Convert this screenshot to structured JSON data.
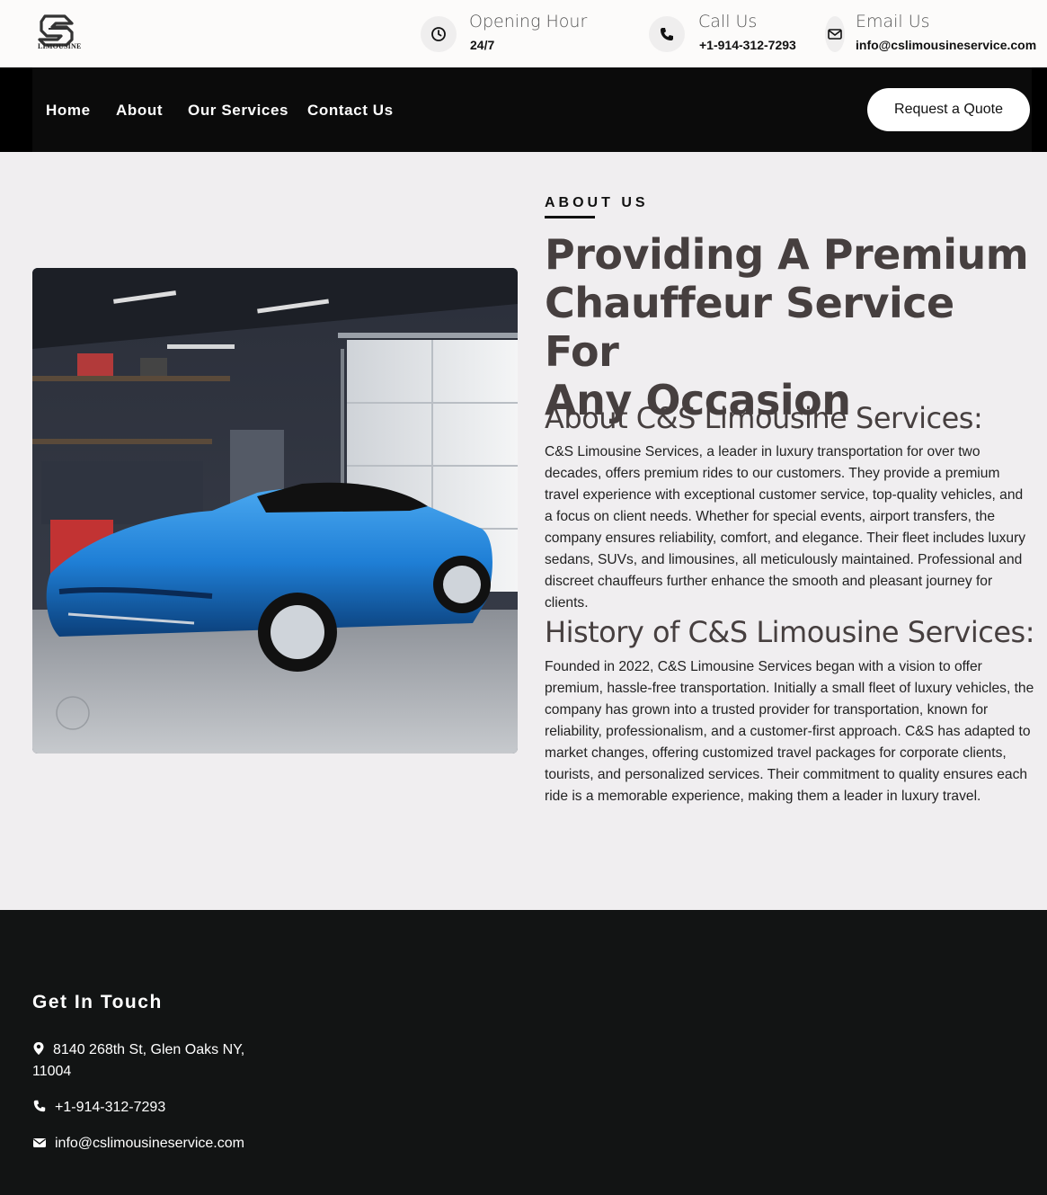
{
  "brand": {
    "logo_text": "LIMOUSINE"
  },
  "topbar": {
    "opening": {
      "title": "Opening Hour",
      "value": "24/7",
      "icon": "clock-icon"
    },
    "call": {
      "title": "Call Us",
      "value": "+1-914-312-7293",
      "icon": "phone-icon"
    },
    "email": {
      "title": "Email Us",
      "value": "info@cslimousineservice.com",
      "icon": "envelope-icon"
    }
  },
  "nav": {
    "items": [
      "Home",
      "About",
      "Our Services",
      "Contact Us"
    ],
    "cta": "Request a Quote"
  },
  "about": {
    "eyebrow": "ABOUT US",
    "headline_1": "Providing A Premium",
    "headline_2": "Chauffeur Service For",
    "headline_3": "Any Occasion",
    "section1_title": "About C&S Limousine Services:",
    "section1_text": "C&S Limousine Services, a leader in luxury transportation for over two decades, offers premium rides to our customers. They provide a premium travel experience with exceptional customer service, top-quality vehicles, and a focus on client needs. Whether for special events, airport transfers, the company ensures reliability, comfort, and elegance. Their fleet includes luxury sedans, SUVs, and limousines, all meticulously maintained. Professional and discreet chauffeurs further enhance the smooth and pleasant journey for clients.",
    "section2_title": "History of C&S Limousine Services:",
    "section2_text": "Founded in 2022, C&S Limousine Services began with a vision to offer premium, hassle-free transportation. Initially a small fleet of luxury vehicles, the company has grown into a trusted provider for transportation, known for reliability, professionalism, and a customer-first approach. C&S has adapted to market changes, offering customized travel packages for corporate clients, tourists, and personalized services. Their commitment to quality ensures each ride is a memorable experience, making them a leader in luxury travel."
  },
  "footer": {
    "title": "Get In Touch",
    "address": "8140 268th St, Glen Oaks NY, 11004",
    "phone": "+1-914-312-7293",
    "email": "info@cslimousineservice.com"
  },
  "colors": {
    "nav_bg": "#0b0b0b",
    "heading": "#463f3f",
    "footer_bg": "#121414",
    "car_blue": "#1f7fd6"
  }
}
